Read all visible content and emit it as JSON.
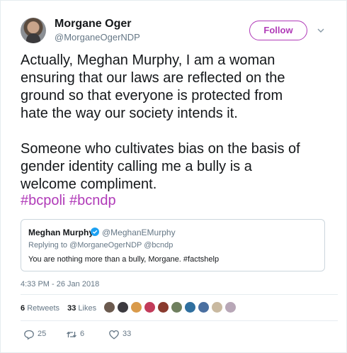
{
  "author": {
    "name": "Morgane Oger",
    "handle": "@MorganeOgerNDP"
  },
  "follow_label": "Follow",
  "tweet": {
    "text": "Actually, Meghan Murphy, I am a woman\nensuring that our laws are reflected on the\nground so that everyone is protected from\nhate the way our society intends it.\n\nSomeone who cultivates bias on the basis of\ngender identity calling me a bully is a\nwelcome compliment.",
    "hashtags": [
      "#bcpoli",
      "#bcndp"
    ]
  },
  "quoted": {
    "name": "Meghan Murphy",
    "handle": "@MeghanEMurphy",
    "reply_to": "Replying to @MorganeOgerNDP @bcndp",
    "text": "You are nothing more than a bully, Morgane. #factshelp"
  },
  "timestamp": "4:33 PM - 26 Jan 2018",
  "stats": {
    "retweets_count": "6",
    "retweets_label": "Retweets",
    "likes_count": "33",
    "likes_label": "Likes"
  },
  "likers": [
    "#6b5a4e",
    "#3c3a3f",
    "#d99a4a",
    "#c23b5a",
    "#8a3a2e",
    "#6f7f5e",
    "#2f6f9f",
    "#4a6fa0",
    "#c9b9a0",
    "#b8a7b7"
  ],
  "actions": {
    "replies": "25",
    "retweets": "6",
    "likes": "33"
  },
  "colors": {
    "accent": "#b03ab8",
    "verified": "#1da1f2",
    "muted": "#657786"
  }
}
